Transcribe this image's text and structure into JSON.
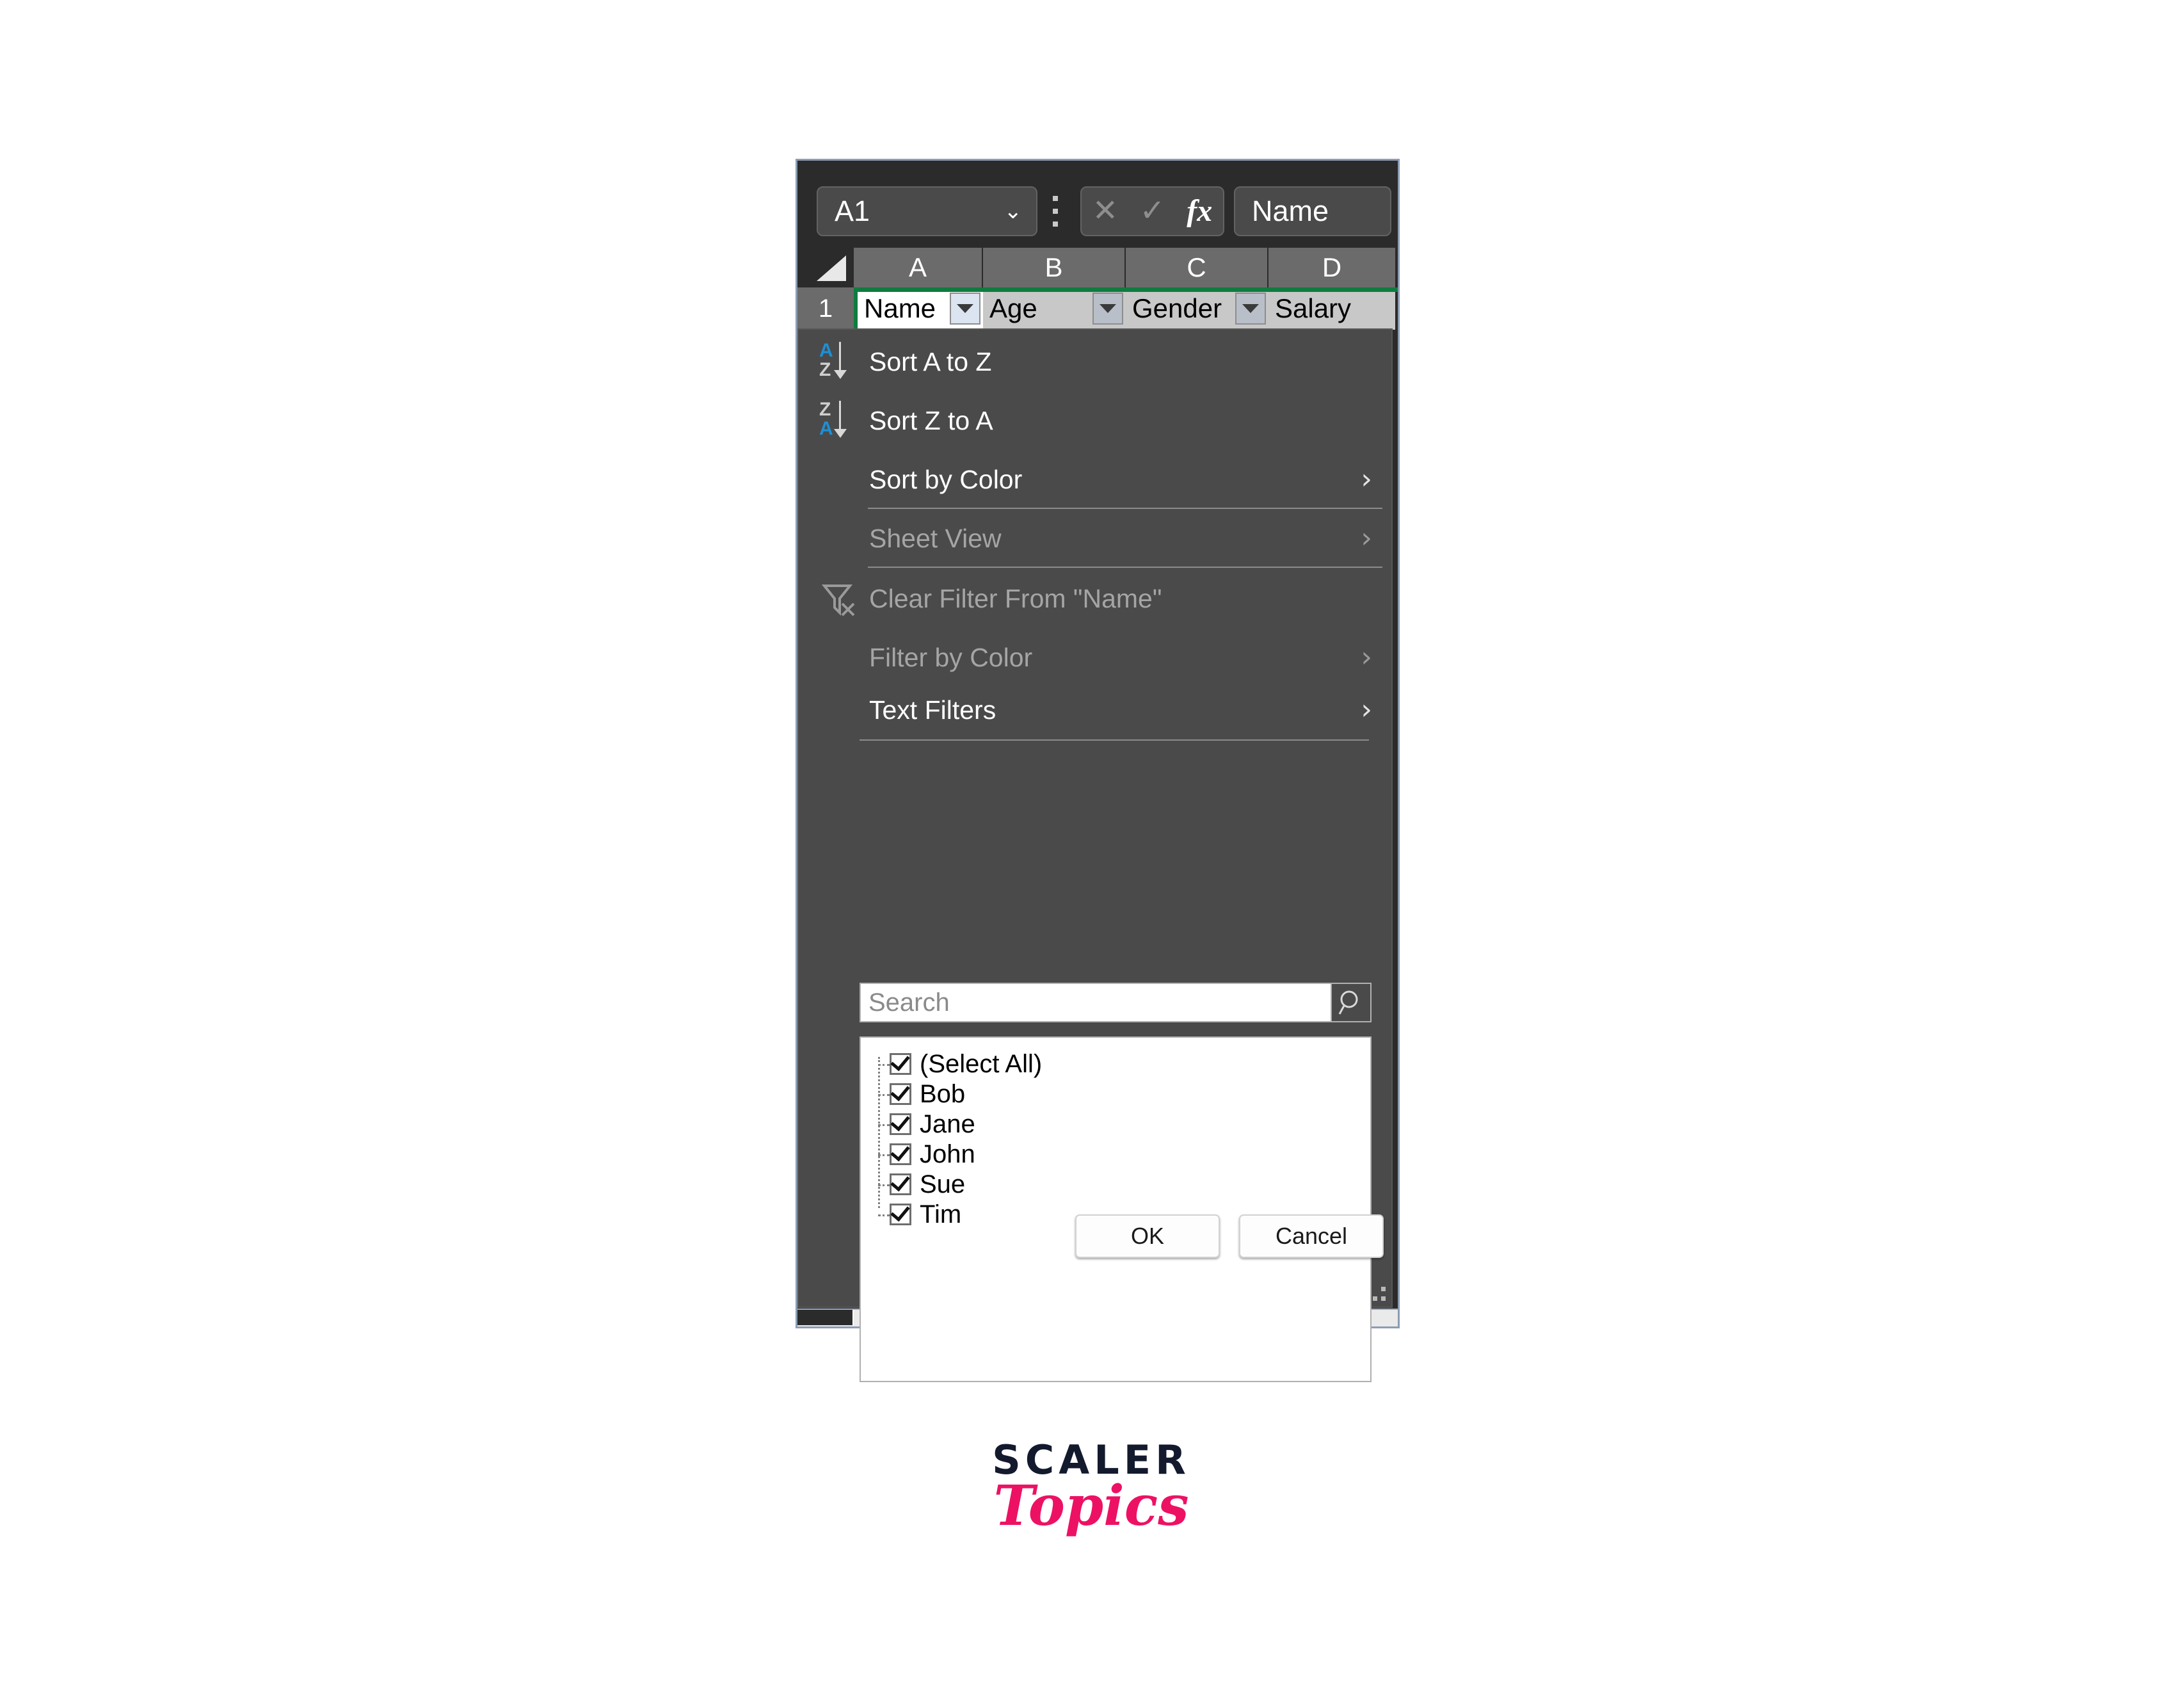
{
  "colors": {
    "toolbar_bg": "#2b2b2b",
    "panel_bg": "#4a4a4a",
    "col_header_bg": "#6b6b6b",
    "table_header_green": "#0f7b3f",
    "accent_blue": "#1e8fd5",
    "logo_dark": "#131a2e",
    "logo_pink": "#ed1164",
    "window_border": "#8d9cb5"
  },
  "formula_bar": {
    "name_box_value": "A1",
    "name_box_chevron": "chevron-down-icon",
    "kebab": "more-options-icon",
    "cancel_icon": "x-icon",
    "confirm_icon": "check-icon",
    "function_icon": "fx",
    "formula_value": "Name"
  },
  "grid": {
    "columns": [
      "A",
      "B",
      "C",
      "D"
    ],
    "row_numbers": [
      "1"
    ],
    "header_cells": [
      "Name",
      "Age",
      "Gender",
      "Salary"
    ],
    "active_cell": "Name"
  },
  "filter_menu": {
    "items": [
      {
        "label": "Sort A to Z",
        "accel": "S",
        "icon": "sort-a-to-z-icon",
        "enabled": true,
        "submenu": false
      },
      {
        "label": "Sort Z to A",
        "accel": "o",
        "icon": "sort-z-to-a-icon",
        "enabled": true,
        "submenu": false
      },
      {
        "label": "Sort by Color",
        "accel": "t",
        "icon": null,
        "enabled": true,
        "submenu": true
      },
      {
        "label": "Sheet View",
        "accel": "V",
        "icon": null,
        "enabled": false,
        "submenu": true
      },
      {
        "label": "Clear Filter From \"Name\"",
        "accel": "C",
        "icon": "clear-filter-icon",
        "enabled": false,
        "submenu": false
      },
      {
        "label": "Filter by Color",
        "accel": "i",
        "icon": null,
        "enabled": false,
        "submenu": true
      },
      {
        "label": "Text Filters",
        "accel": "F",
        "icon": null,
        "enabled": true,
        "submenu": true
      }
    ],
    "search": {
      "placeholder": "Search",
      "value": "",
      "icon": "search-icon"
    },
    "value_list": [
      {
        "label": "(Select All)",
        "checked": true
      },
      {
        "label": "Bob",
        "checked": true
      },
      {
        "label": "Jane",
        "checked": true
      },
      {
        "label": "John",
        "checked": true
      },
      {
        "label": "Sue",
        "checked": true
      },
      {
        "label": "Tim",
        "checked": true
      }
    ],
    "ok_label": "OK",
    "cancel_label": "Cancel",
    "resize_grip": "resize-grip-icon"
  },
  "logo": {
    "top": "SCALER",
    "bottom": "Topics"
  }
}
